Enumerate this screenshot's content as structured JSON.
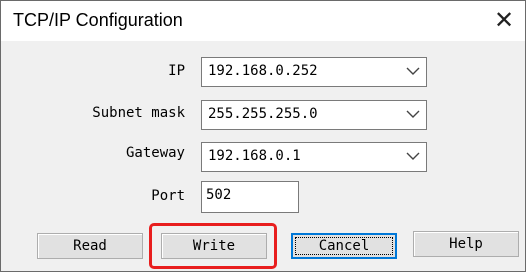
{
  "window": {
    "title": "TCP/IP Configuration"
  },
  "fields": {
    "ip_label": "IP",
    "ip_value": "192.168.0.252",
    "subnet_label": "Subnet mask",
    "subnet_value": "255.255.255.0",
    "gateway_label": "Gateway",
    "gateway_value": "192.168.0.1",
    "port_label": "Port",
    "port_value": "502"
  },
  "buttons": {
    "read": "Read",
    "write": "Write",
    "cancel": "Cancel",
    "help": "Help"
  },
  "icons": {
    "close": "close-icon",
    "dropdown": "chevron-down-icon"
  },
  "colors": {
    "highlight": "#e81e1e",
    "default_button": "#0078d7"
  }
}
